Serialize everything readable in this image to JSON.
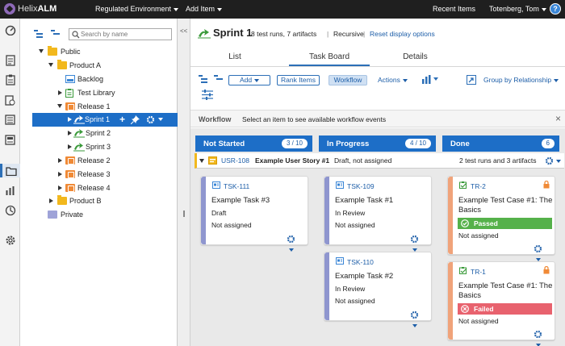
{
  "topbar": {
    "brand_prefix": "Helix",
    "brand_suffix": "ALM",
    "project": "Regulated Environment",
    "add_item": "Add Item",
    "recent_items": "Recent Items",
    "user": "Totenberg, Tom",
    "help": "?"
  },
  "rail": {
    "icons": [
      "dashboard-icon",
      "requirements-icon",
      "test-cases-icon",
      "test-runs-icon",
      "issues-icon",
      "documents-icon",
      "folders-icon",
      "reports-icon",
      "automation-icon",
      "settings-icon"
    ]
  },
  "tree": {
    "search_placeholder": "Search by name",
    "items": [
      {
        "label": "Public"
      },
      {
        "label": "Product A"
      },
      {
        "label": "Backlog"
      },
      {
        "label": "Test Library"
      },
      {
        "label": "Release 1"
      },
      {
        "label": "Sprint 1"
      },
      {
        "label": "Sprint 2"
      },
      {
        "label": "Sprint 3"
      },
      {
        "label": "Release 2"
      },
      {
        "label": "Release 3"
      },
      {
        "label": "Release 4"
      },
      {
        "label": "Product B"
      },
      {
        "label": "Private"
      }
    ]
  },
  "splitter": {
    "collapse": "<<"
  },
  "header": {
    "title": "Sprint 1",
    "summary": "8 test runs, 7 artifacts",
    "sep": "|",
    "recursive": "Recursive",
    "reset": "Reset display options"
  },
  "tabs": [
    {
      "label": "List"
    },
    {
      "label": "Task Board"
    },
    {
      "label": "Details"
    }
  ],
  "toolbar": {
    "add": "Add",
    "rank_items": "Rank Items",
    "workflow": "Workflow",
    "actions": "Actions",
    "group_by": "Group by Relationship"
  },
  "workflow_bar": {
    "title": "Workflow",
    "message": "Select an item to see available workflow events",
    "close": "×"
  },
  "columns": [
    {
      "name": "Not Started",
      "count": "3 / 10"
    },
    {
      "name": "In Progress",
      "count": "4 / 10"
    },
    {
      "name": "Done",
      "count": "6"
    }
  ],
  "story": {
    "id": "USR-108",
    "title": "Example User Story #1",
    "detail": "Draft, not assigned",
    "related": "2 test runs and 3 artifacts"
  },
  "cards": {
    "tsk111": {
      "id": "TSK-111",
      "title": "Example Task #3",
      "status": "Draft",
      "assignee": "Not assigned"
    },
    "tsk109": {
      "id": "TSK-109",
      "title": "Example Task #1",
      "status": "In Review",
      "assignee": "Not assigned"
    },
    "tsk110": {
      "id": "TSK-110",
      "title": "Example Task #2",
      "status": "In Review",
      "assignee": "Not assigned"
    },
    "tr2": {
      "id": "TR-2",
      "title_line1": "Example Test Case #1: The",
      "title_line2": "Basics",
      "result": "Passed",
      "assignee": "Not assigned"
    },
    "tr1": {
      "id": "TR-1",
      "title_line1": "Example Test Case #1: The",
      "title_line2": "Basics",
      "result": "Failed",
      "assignee": "Not assigned"
    }
  },
  "colors": {
    "topbar": "#1f1f1f",
    "accent": "#1d6ec7",
    "passed": "#55b14a",
    "failed": "#e8626e",
    "task_bar": "#8f96cf",
    "run_bar": "#f0a37a",
    "folder": "#f2b81d",
    "release": "#f08a36"
  }
}
